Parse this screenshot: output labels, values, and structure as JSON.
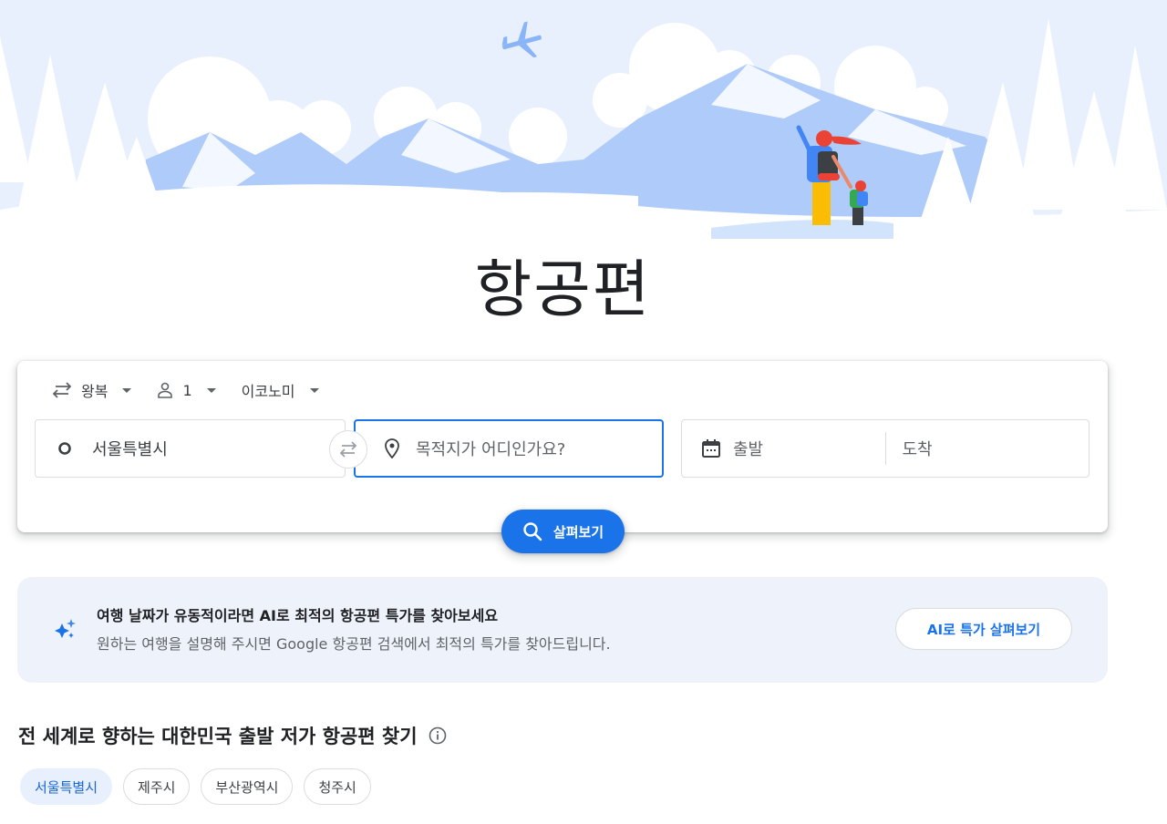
{
  "page": {
    "title": "항공편"
  },
  "search": {
    "trip_type": "왕복",
    "passengers": "1",
    "cabin_class": "이코노미",
    "origin": "서울특별시",
    "destination_placeholder": "목적지가 어디인가요?",
    "depart_placeholder": "출발",
    "return_placeholder": "도착",
    "explore_label": "살펴보기"
  },
  "ai_banner": {
    "title": "여행 날짜가 유동적이라면 AI로 최적의 항공편 특가를 찾아보세요",
    "subtitle": "원하는 여행을 설명해 주시면 Google 항공편 검색에서 최적의 특가를 찾아드립니다.",
    "button_label": "AI로 특가 살펴보기"
  },
  "deals": {
    "title": "전 세계로 향하는 대한민국 출발 저가 항공편 찾기",
    "cities": [
      "서울특별시",
      "제주시",
      "부산광역시",
      "청주시"
    ]
  },
  "colors": {
    "accent": "#1a73e8",
    "hero_sky": "#e8f0fe",
    "hero_mountain": "#aecbfa",
    "banner_bg": "#eef3fb"
  }
}
